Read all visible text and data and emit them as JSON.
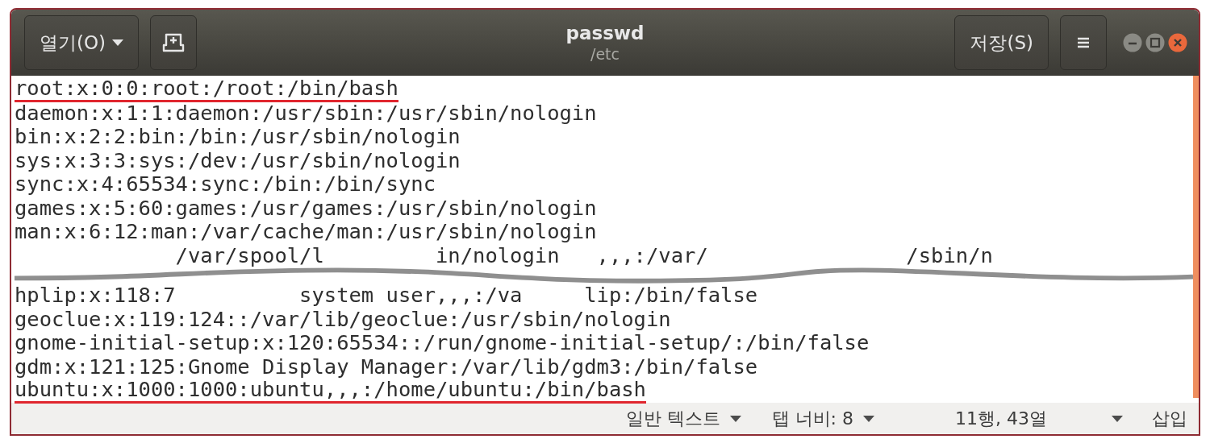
{
  "window": {
    "title": "passwd",
    "subtitle": "/etc",
    "controls": [
      {
        "kind": "minimize"
      },
      {
        "kind": "maximize"
      },
      {
        "kind": "close"
      }
    ]
  },
  "header": {
    "open_button": "열기(O)",
    "save_button": "저장(S)"
  },
  "lines": [
    {
      "kind": "line",
      "text": "root:x:0:0:root:/root:/bin/bash",
      "underlined": true
    },
    {
      "kind": "line",
      "text": "daemon:x:1:1:daemon:/usr/sbin:/usr/sbin/nologin",
      "underlined": false
    },
    {
      "kind": "line",
      "text": "bin:x:2:2:bin:/bin:/usr/sbin/nologin",
      "underlined": false
    },
    {
      "kind": "line",
      "text": "sys:x:3:3:sys:/dev:/usr/sbin/nologin",
      "underlined": false
    },
    {
      "kind": "line",
      "text": "sync:x:4:65534:sync:/bin:/bin/sync",
      "underlined": false
    },
    {
      "kind": "line",
      "text": "games:x:5:60:games:/usr/games:/usr/sbin/nologin",
      "underlined": false
    },
    {
      "kind": "line",
      "text": "man:x:6:12:man:/var/cache/man:/usr/sbin/nologin",
      "underlined": false
    },
    {
      "kind": "line",
      "text": "             /var/spool/l         in/nologin   ,,,:/var/                /sbin/n",
      "underlined": false
    },
    {
      "kind": "tear"
    },
    {
      "kind": "line",
      "text": "hplip:x:118:7          system user,,,:/va     lip:/bin/false",
      "underlined": false
    },
    {
      "kind": "line",
      "text": "geoclue:x:119:124::/var/lib/geoclue:/usr/sbin/nologin",
      "underlined": false
    },
    {
      "kind": "line",
      "text": "gnome-initial-setup:x:120:65534::/run/gnome-initial-setup/:/bin/false",
      "underlined": false
    },
    {
      "kind": "line",
      "text": "gdm:x:121:125:Gnome Display Manager:/var/lib/gdm3:/bin/false",
      "underlined": false
    },
    {
      "kind": "line",
      "text": "ubuntu:x:1000:1000:ubuntu,,,:/home/ubuntu:/bin/bash",
      "underlined": true
    }
  ],
  "status_bar": {
    "language": "일반 텍스트",
    "tab_width": "탭 너비: 8",
    "position": "11행, 43열",
    "mode": "삽입"
  }
}
